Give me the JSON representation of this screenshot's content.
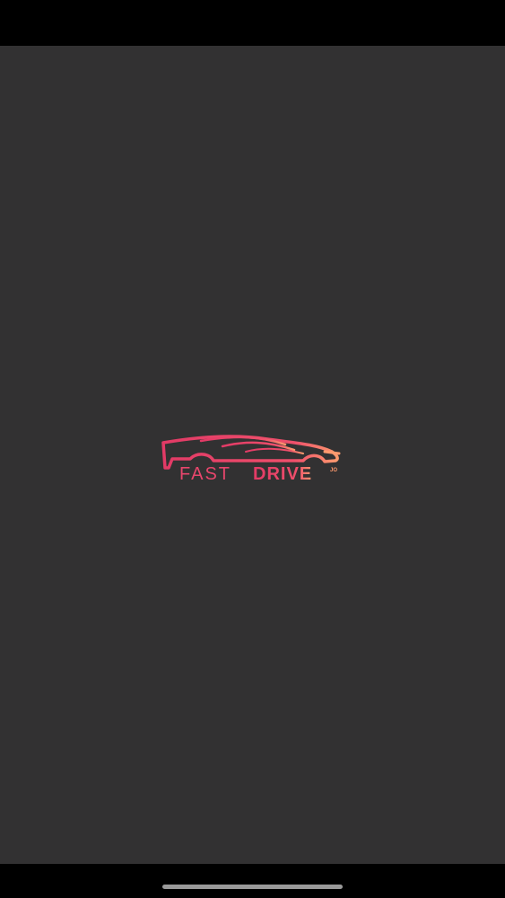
{
  "app": {
    "logo": {
      "word_fast": "FAST",
      "word_drive": "DRIVE",
      "suffix": "JO",
      "icon": "sports-car-icon"
    }
  },
  "colors": {
    "background": "#323132",
    "bars": "#000000",
    "brand": "#e8466c",
    "brand_accent": "#ff8f6b",
    "home_indicator": "#9a9a9a"
  }
}
